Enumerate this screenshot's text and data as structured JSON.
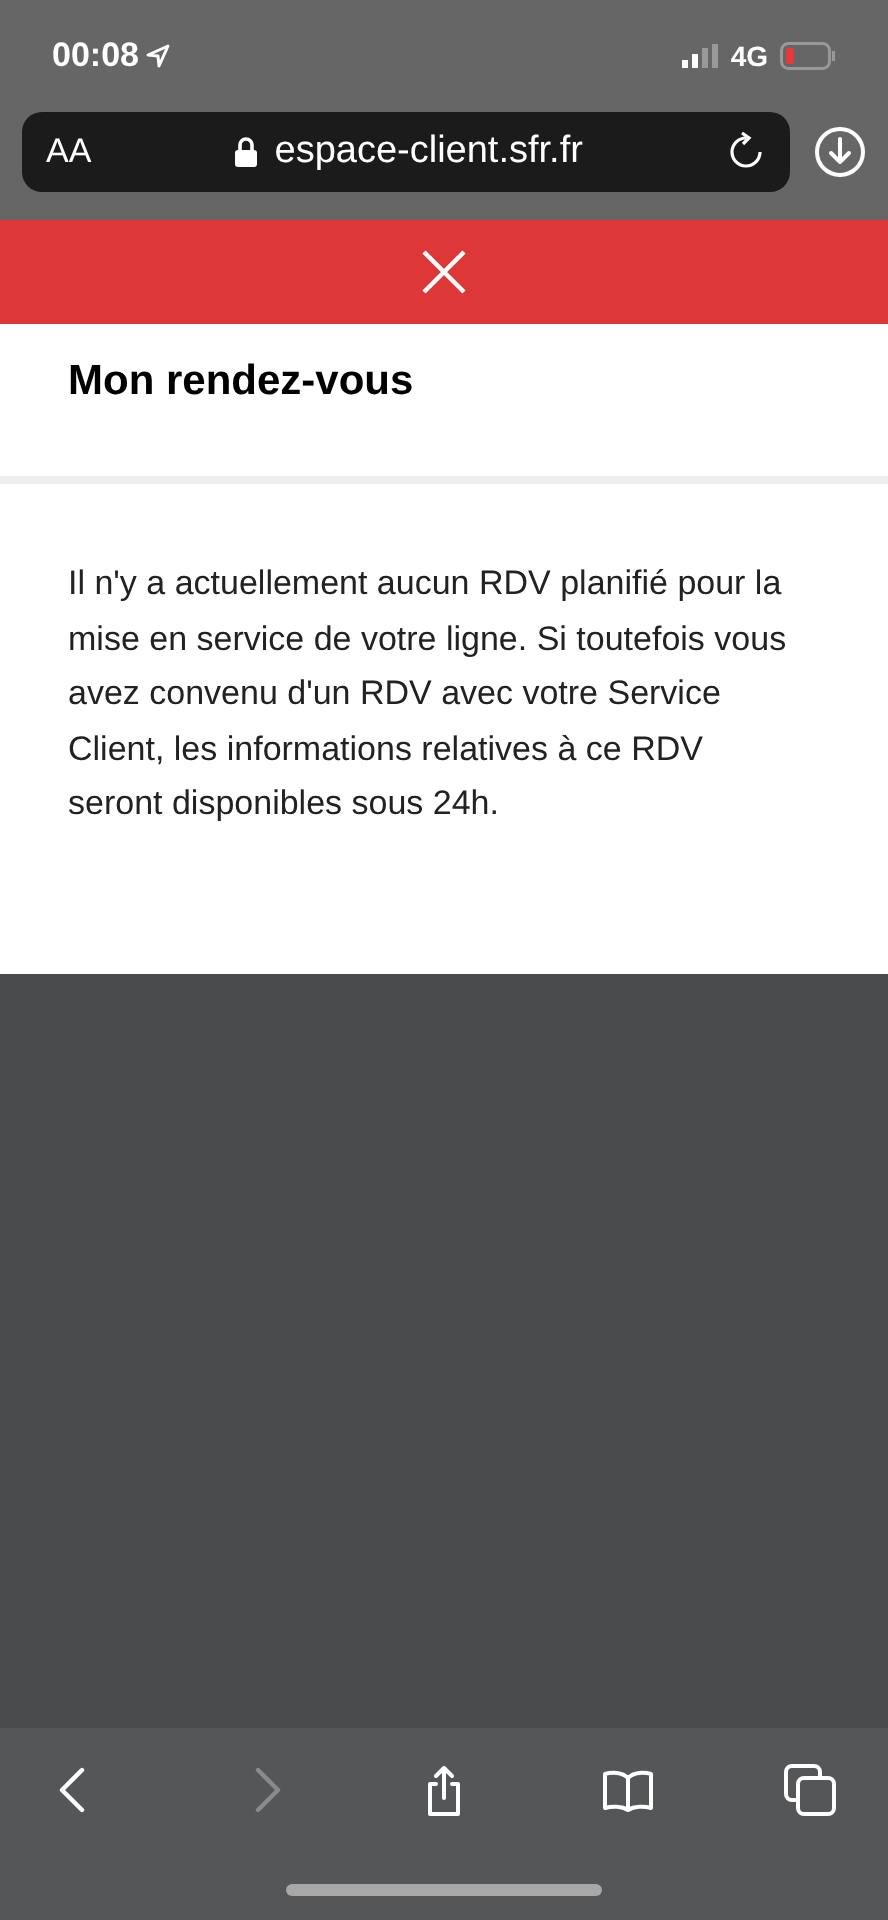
{
  "status_bar": {
    "time": "00:08",
    "network": "4G"
  },
  "address_bar": {
    "text_size": "AA",
    "url": "espace-client.sfr.fr"
  },
  "page": {
    "title": "Mon rendez-vous",
    "message": "Il n'y a actuellement aucun RDV planifié pour la mise en service de votre ligne. Si toutefois vous avez convenu d'un RDV avec votre Service Client, les informations relatives à ce RDV seront disponibles sous 24h."
  },
  "toolbar": [
    {
      "kind": "back",
      "disabled": false
    },
    {
      "kind": "forward",
      "disabled": true
    },
    {
      "kind": "share",
      "disabled": false
    },
    {
      "kind": "bookmarks",
      "disabled": false
    },
    {
      "kind": "tabs",
      "disabled": false
    }
  ]
}
